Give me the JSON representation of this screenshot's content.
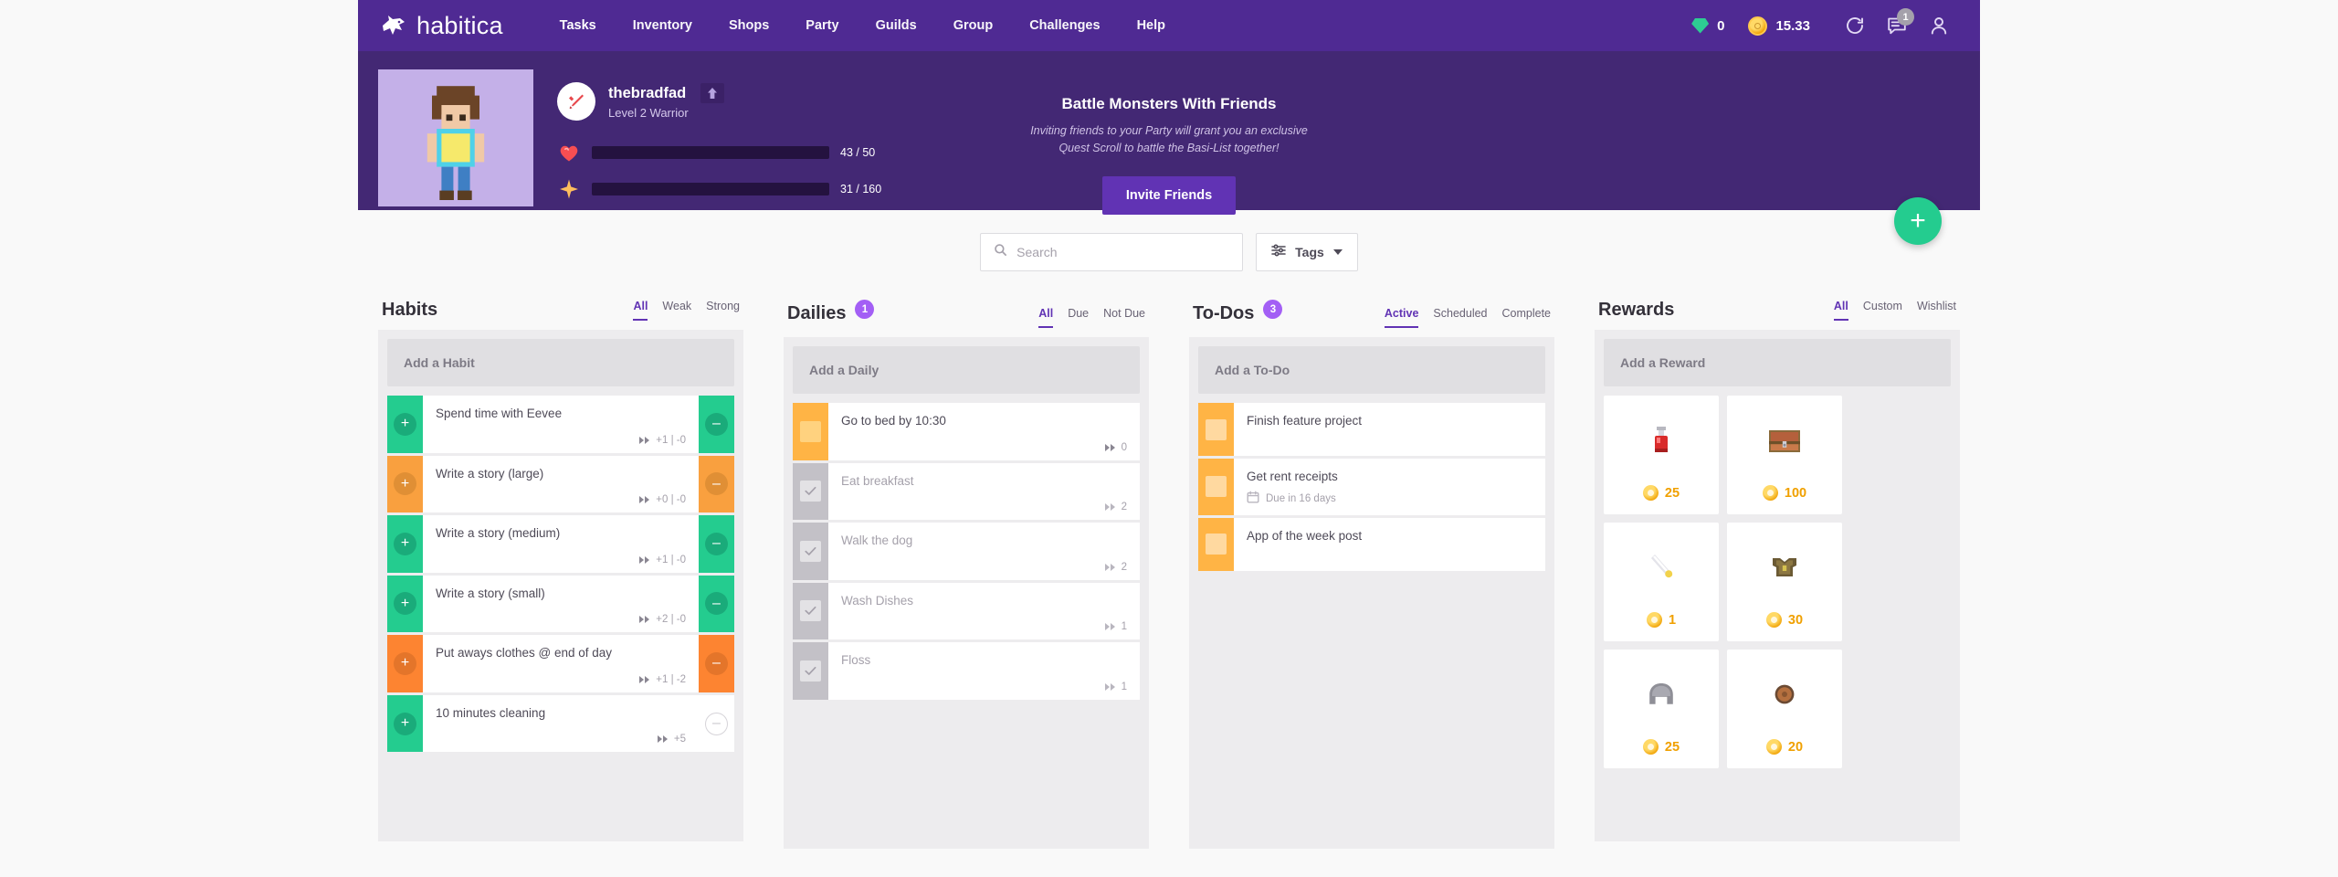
{
  "app": {
    "brand": "habitica"
  },
  "nav": {
    "links": [
      {
        "label": "Tasks",
        "active": true
      },
      {
        "label": "Inventory",
        "active": false
      },
      {
        "label": "Shops",
        "active": false
      },
      {
        "label": "Party",
        "active": false
      },
      {
        "label": "Guilds",
        "active": false
      },
      {
        "label": "Group",
        "active": false
      },
      {
        "label": "Challenges",
        "active": false
      },
      {
        "label": "Help",
        "active": false
      }
    ],
    "gems": "0",
    "gold": "15.33",
    "chat_badge": "1"
  },
  "user": {
    "name": "thebradfad",
    "class_line": "Level 2 Warrior",
    "hp": {
      "value": "43 / 50",
      "percent": 86
    },
    "xp": {
      "value": "31 / 160",
      "percent": 19
    }
  },
  "party": {
    "title": "Battle Monsters With Friends",
    "subtitle_line1": "Inviting friends to your Party will grant you an exclusive",
    "subtitle_line2": "Quest Scroll to battle the Basi-List together!",
    "invite_label": "Invite Friends"
  },
  "toolbar": {
    "search_placeholder": "Search",
    "tags_label": "Tags",
    "add_task_label": "+"
  },
  "columns": {
    "habits": {
      "title": "Habits",
      "tabs": [
        {
          "label": "All",
          "active": true
        },
        {
          "label": "Weak",
          "active": false
        },
        {
          "label": "Strong",
          "active": false
        }
      ],
      "add_label": "Add a Habit",
      "tasks": [
        {
          "title": "Spend time with Eevee",
          "counter": "+1 | -0",
          "color": "green",
          "minus_disabled": false
        },
        {
          "title": "Write a story (large)",
          "counter": "+0 | -0",
          "color": "orange",
          "minus_disabled": false
        },
        {
          "title": "Write a story (medium)",
          "counter": "+1 | -0",
          "color": "green",
          "minus_disabled": false
        },
        {
          "title": "Write a story (small)",
          "counter": "+2 | -0",
          "color": "green",
          "minus_disabled": false
        },
        {
          "title": "Put aways clothes @ end of day",
          "counter": "+1 | -2",
          "color": "orange-dark",
          "minus_disabled": false
        },
        {
          "title": "10 minutes cleaning",
          "counter": "+5",
          "color": "green",
          "minus_disabled": true
        }
      ]
    },
    "dailies": {
      "title": "Dailies",
      "badge": "1",
      "tabs": [
        {
          "label": "All",
          "active": true
        },
        {
          "label": "Due",
          "active": false
        },
        {
          "label": "Not Due",
          "active": false
        }
      ],
      "add_label": "Add a Daily",
      "tasks": [
        {
          "title": "Go to bed by 10:30",
          "streak": "0",
          "done": false
        },
        {
          "title": "Eat breakfast",
          "streak": "2",
          "done": true
        },
        {
          "title": "Walk the dog",
          "streak": "2",
          "done": true
        },
        {
          "title": "Wash Dishes",
          "streak": "1",
          "done": true
        },
        {
          "title": "Floss",
          "streak": "1",
          "done": true
        }
      ]
    },
    "todos": {
      "title": "To-Dos",
      "badge": "3",
      "tabs": [
        {
          "label": "Active",
          "active": true
        },
        {
          "label": "Scheduled",
          "active": false
        },
        {
          "label": "Complete",
          "active": false
        }
      ],
      "add_label": "Add a To-Do",
      "tasks": [
        {
          "title": "Finish feature project",
          "due": ""
        },
        {
          "title": "Get rent receipts",
          "due": "Due in 16 days"
        },
        {
          "title": "App of the week post",
          "due": ""
        }
      ]
    },
    "rewards": {
      "title": "Rewards",
      "tabs": [
        {
          "label": "All",
          "active": true
        },
        {
          "label": "Custom",
          "active": false
        },
        {
          "label": "Wishlist",
          "active": false
        }
      ],
      "add_label": "Add a Reward",
      "items": [
        {
          "icon": "health-potion",
          "cost": "25"
        },
        {
          "icon": "treasure-chest",
          "cost": "100"
        },
        {
          "icon": "weapon-sword",
          "cost": "1"
        },
        {
          "icon": "armor",
          "cost": "30"
        },
        {
          "icon": "helmet",
          "cost": "25"
        },
        {
          "icon": "shield",
          "cost": "20"
        }
      ]
    }
  },
  "colors": {
    "brand_purple": "#4f2a93",
    "header_purple": "#432874",
    "accent_purple": "#6133b4",
    "green": "#24cc8f",
    "orange": "#f9a03f",
    "hp_red": "#f74e52",
    "xp_gold": "#ffbe5d",
    "gold": "#f0a000"
  }
}
